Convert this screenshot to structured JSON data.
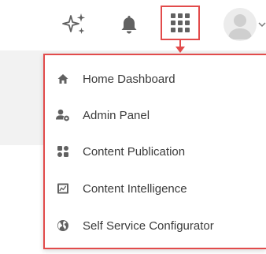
{
  "header": {
    "icons": [
      "sparkle-icon",
      "bell-icon",
      "apps-grid-icon",
      "avatar",
      "chevron-down-icon"
    ],
    "highlight_color": "#e24b4b"
  },
  "menu": {
    "items": [
      {
        "label": "Home Dashboard",
        "icon": "home-icon"
      },
      {
        "label": "Admin Panel",
        "icon": "admin-user-icon"
      },
      {
        "label": "Content Publication",
        "icon": "grid-tiles-icon"
      },
      {
        "label": "Content Intelligence",
        "icon": "analytics-chart-icon"
      },
      {
        "label": "Self Service Configurator",
        "icon": "globe-icon"
      }
    ]
  },
  "colors": {
    "icon": "#616161",
    "text": "#3b3b3b",
    "accent": "#e24b4b"
  }
}
